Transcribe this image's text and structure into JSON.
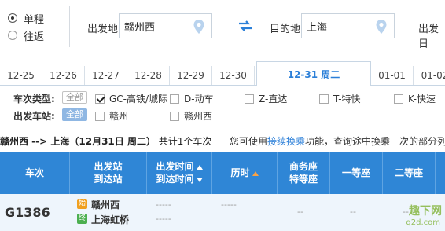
{
  "trip_type": {
    "options": [
      "单程",
      "往返"
    ],
    "selected": 0
  },
  "search": {
    "from_label": "出发地",
    "from_value": "赣州西",
    "to_label": "目的地",
    "to_value": "上海",
    "date_label": "出发日"
  },
  "date_tabs": [
    "12-25",
    "12-26",
    "12-27",
    "12-28",
    "12-29",
    "12-30",
    "12-31 周二",
    "01-01",
    "01-02"
  ],
  "active_date_index": 6,
  "filters": {
    "type_label": "车次类型:",
    "station_label": "出发车站:",
    "all_label": "全部",
    "types": [
      {
        "label": "GC-高铁/城际",
        "checked": true
      },
      {
        "label": "D-动车",
        "checked": false
      },
      {
        "label": "Z-直达",
        "checked": false
      },
      {
        "label": "T-特快",
        "checked": false
      },
      {
        "label": "K-快速",
        "checked": false
      }
    ],
    "stations": [
      {
        "label": "赣州",
        "checked": false
      },
      {
        "label": "赣州西",
        "checked": false
      }
    ]
  },
  "summary": {
    "route": "赣州西 --> 上海（12月31日 周二）",
    "count_text": "共计1个车次",
    "hint_pre": "您可使用",
    "hint_link": "接续换乘",
    "hint_post": "功能，查询途中换乘一次的部分列"
  },
  "table_header": {
    "train": "车次",
    "station_1": "出发站",
    "station_2": "到达站",
    "time_1": "出发时间",
    "time_2": "到达时间",
    "duration": "历时",
    "business_1": "商务座",
    "business_2": "特等座",
    "first": "一等座",
    "second": "二等座"
  },
  "rows": [
    {
      "train": "G1386",
      "from_badge": "始",
      "from_station": "赣州西",
      "to_badge": "终",
      "to_station": "上海虹桥",
      "depart": "-----",
      "arrive": "-----",
      "duration": "-----",
      "business": "--",
      "first": "--",
      "second": "--"
    }
  ],
  "watermark": {
    "text": "趣下网",
    "url": "q2d.com"
  },
  "colors": {
    "accent": "#2b7fd8",
    "header_bg": "#2f86d6",
    "start_badge": "#f0a020",
    "end_badge": "#4caf50"
  }
}
